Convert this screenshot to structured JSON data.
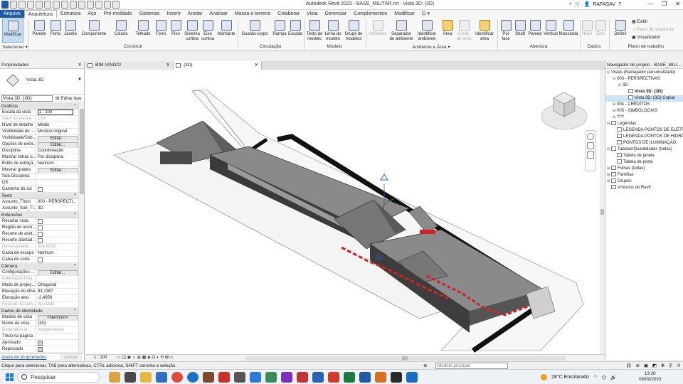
{
  "window": {
    "title": "Autodesk Revit 2023 - BASE_MILITAR.rvt - Vista 3D: {3D}",
    "user": "RAFASAV",
    "controls": [
      "—",
      "❐",
      "✕"
    ]
  },
  "tabs": [
    "Arquivo",
    "Arquitetura",
    "Estrutura",
    "Aço",
    "Pré-moldado",
    "Sistemas",
    "Inserir",
    "Anotar",
    "Analisar",
    "Massa e terreno",
    "Colaborar",
    "Vista",
    "Gerenciar",
    "Complementos",
    "Modificar",
    "⊡ ▾"
  ],
  "ribbon": {
    "modify": "Modificar",
    "selecionar": "Selecionar ▾",
    "construir": {
      "label": "Construir",
      "items": [
        "Parede",
        "Porta",
        "Janela",
        "Componente",
        "Coluna",
        "Telhado",
        "Forro",
        "Piso",
        "Sistema cortina",
        "Eixo cortina",
        "Montante"
      ]
    },
    "circulacao": {
      "label": "Circulação",
      "items": [
        "Guarda-corpo",
        "Rampa",
        "Escada"
      ]
    },
    "modelo": {
      "label": "Modelo",
      "items": [
        "Texto do modelo",
        "Linha do modelo",
        "Grupo de modelos"
      ]
    },
    "ambiente": {
      "label": "Ambiente e Área ▾",
      "items": [
        "Ambiente",
        "Separador de ambiente",
        "Identificar ambiente",
        "Área",
        "Limite de área",
        "Identificar área"
      ]
    },
    "abertura": {
      "label": "Abertura",
      "items": [
        "Por face",
        "Shaft",
        "Parede",
        "Vertical",
        "Mansarda"
      ]
    },
    "dados": {
      "label": "Dados",
      "items": [
        "Nível",
        "Eixo"
      ]
    },
    "plano": {
      "label": "Plano de trabalho",
      "define": "Definir",
      "small": [
        "Exibir",
        "Plano de referência",
        "Visualizador"
      ]
    }
  },
  "properties": {
    "header": "Propriedades",
    "type_name": "Vista 3D",
    "view_selector": "Vista 3D: {3D}",
    "edit_type": "Editar tipo",
    "sections": [
      {
        "name": "Gráficos",
        "rows": [
          {
            "k": "Escala da vista",
            "v": "1 : 100",
            "kind": "box"
          },
          {
            "k": "Valor de escala ...",
            "v": "100",
            "kind": "dis"
          },
          {
            "k": "Nível de detalhe",
            "v": "Médio"
          },
          {
            "k": "Visibilidade de ...",
            "v": "Mostrar original"
          },
          {
            "k": "Visibilidade/Sob...",
            "v": "Editar...",
            "kind": "btn"
          },
          {
            "k": "Opções de exibi...",
            "v": "Editar...",
            "kind": "btn"
          },
          {
            "k": "Disciplina",
            "v": "Coordenação"
          },
          {
            "k": "Mostrar linhas o...",
            "v": "Por disciplina"
          },
          {
            "k": "Estilo de exibiçã...",
            "v": "Nenhum"
          },
          {
            "k": "Mostrar grades",
            "v": "Editar...",
            "kind": "btn"
          },
          {
            "k": "Sub-Disciplina",
            "v": ""
          },
          {
            "k": "OS",
            "v": ""
          },
          {
            "k": "Caminho do sol",
            "v": "",
            "kind": "cb"
          }
        ]
      },
      {
        "name": "Texto",
        "rows": [
          {
            "k": "Assunto_Título",
            "v": "003 - PERSPECTI..."
          },
          {
            "k": "Assunto_Sub_Tí...",
            "v": "3D"
          }
        ]
      },
      {
        "name": "Extensões",
        "rows": [
          {
            "k": "Recortar vista",
            "v": "",
            "kind": "cb"
          },
          {
            "k": "Região de recor...",
            "v": "",
            "kind": "cb"
          },
          {
            "k": "Recorte de anot...",
            "v": "",
            "kind": "cb"
          },
          {
            "k": "Recorte afastad...",
            "v": "",
            "kind": "cb"
          },
          {
            "k": "Deslocamento ...",
            "v": "304,8000",
            "kind": "dis"
          },
          {
            "k": "Caixa de escopo",
            "v": "Nenhum"
          },
          {
            "k": "Caixa de corte",
            "v": "",
            "kind": "cb"
          }
        ]
      },
      {
        "name": "Câmera",
        "rows": [
          {
            "k": "Configurações ...",
            "v": "Editar...",
            "kind": "btn"
          },
          {
            "k": "Orientação bloq...",
            "v": "",
            "kind": "dis"
          },
          {
            "k": "Modo de projeç...",
            "v": "Ortogonal"
          },
          {
            "k": "Elevação do olho",
            "v": "83,1367"
          },
          {
            "k": "Elevação alvo",
            "v": "-2,4956"
          },
          {
            "k": "Posição da câm...",
            "v": "Ajustada",
            "kind": "dis"
          }
        ]
      },
      {
        "name": "Dados de identidade",
        "rows": [
          {
            "k": "Modelo de vista",
            "v": "<Nenhum>",
            "kind": "btn"
          },
          {
            "k": "Nome da vista",
            "v": "{3D}"
          },
          {
            "k": "Dependência",
            "v": "Independente",
            "kind": "dis"
          },
          {
            "k": "Título na página",
            "v": ""
          },
          {
            "k": "Aprovado",
            "v": "",
            "kind": "cbon"
          },
          {
            "k": "Reprovado",
            "v": "",
            "kind": "cbon"
          }
        ]
      }
    ],
    "help_link": "Ajuda de propriedades",
    "apply": "Aplicar"
  },
  "view_tabs": [
    {
      "label": "BIM-VINDO!",
      "active": false
    },
    {
      "label": "{3D}",
      "active": true
    }
  ],
  "view_status": "1 : 100",
  "project_browser": {
    "header": "Navegador de projeto - BASE_MILI...",
    "nodes": [
      {
        "lvl": 0,
        "exp": "⊟",
        "label": "Vistas (Navegador personalizado)"
      },
      {
        "lvl": 1,
        "exp": "⊟",
        "label": "003 - PERSPECTIVAS"
      },
      {
        "lvl": 2,
        "exp": "⊟",
        "label": "3D"
      },
      {
        "lvl": 3,
        "exp": "",
        "label": "Vista 3D: {3D}",
        "bold": true,
        "icon": true
      },
      {
        "lvl": 3,
        "exp": "",
        "label": "Vista 3D: {3D} Copiar",
        "sel": true,
        "icon": true
      },
      {
        "lvl": 1,
        "exp": "⊞",
        "label": "004 - CRÉDITOS"
      },
      {
        "lvl": 1,
        "exp": "⊞",
        "label": "005 - SIMBOLOGIAS"
      },
      {
        "lvl": 1,
        "exp": "⊞",
        "label": "???"
      },
      {
        "lvl": 0,
        "exp": "⊟",
        "label": "Legendas",
        "icon": true
      },
      {
        "lvl": 1,
        "exp": "",
        "label": "LEGENDA PONTOS DE ELÉTRI",
        "icon": true
      },
      {
        "lvl": 1,
        "exp": "",
        "label": "LEGENDA PONTOS DE HIDRÁ",
        "icon": true
      },
      {
        "lvl": 1,
        "exp": "",
        "label": "PONTOS DE ILUMINAÇÃO",
        "icon": true
      },
      {
        "lvl": 0,
        "exp": "⊟",
        "label": "Tabelas/Quantidades (todas)",
        "icon": true
      },
      {
        "lvl": 1,
        "exp": "",
        "label": "Tabela de janela",
        "icon": true
      },
      {
        "lvl": 1,
        "exp": "",
        "label": "Tabela de porta",
        "icon": true
      },
      {
        "lvl": 0,
        "exp": "⊞",
        "label": "Folhas (todas)",
        "icon": true
      },
      {
        "lvl": 0,
        "exp": "⊞",
        "label": "Famílias",
        "icon": true
      },
      {
        "lvl": 0,
        "exp": "⊞",
        "label": "Grupos",
        "icon": true
      },
      {
        "lvl": 0,
        "exp": "",
        "label": "Vínculos do Revit",
        "icon": true
      }
    ]
  },
  "status_bar": {
    "message": "Clique para selecionar, TAB para alternativas, CTRL adiciona, SHIFT cancela a seleção.",
    "model": "Modelo principal",
    "zero": ":0"
  },
  "taskbar": {
    "search": "Pesquisar",
    "weather": "28°C  Ensolarado",
    "time": "13:20",
    "date": "08/09/2023"
  },
  "colors": {
    "file_tab": "#1e5aa8",
    "highlight": "#c5dcf5",
    "roof": "#6f6f6f",
    "red_trim": "#d02424"
  }
}
